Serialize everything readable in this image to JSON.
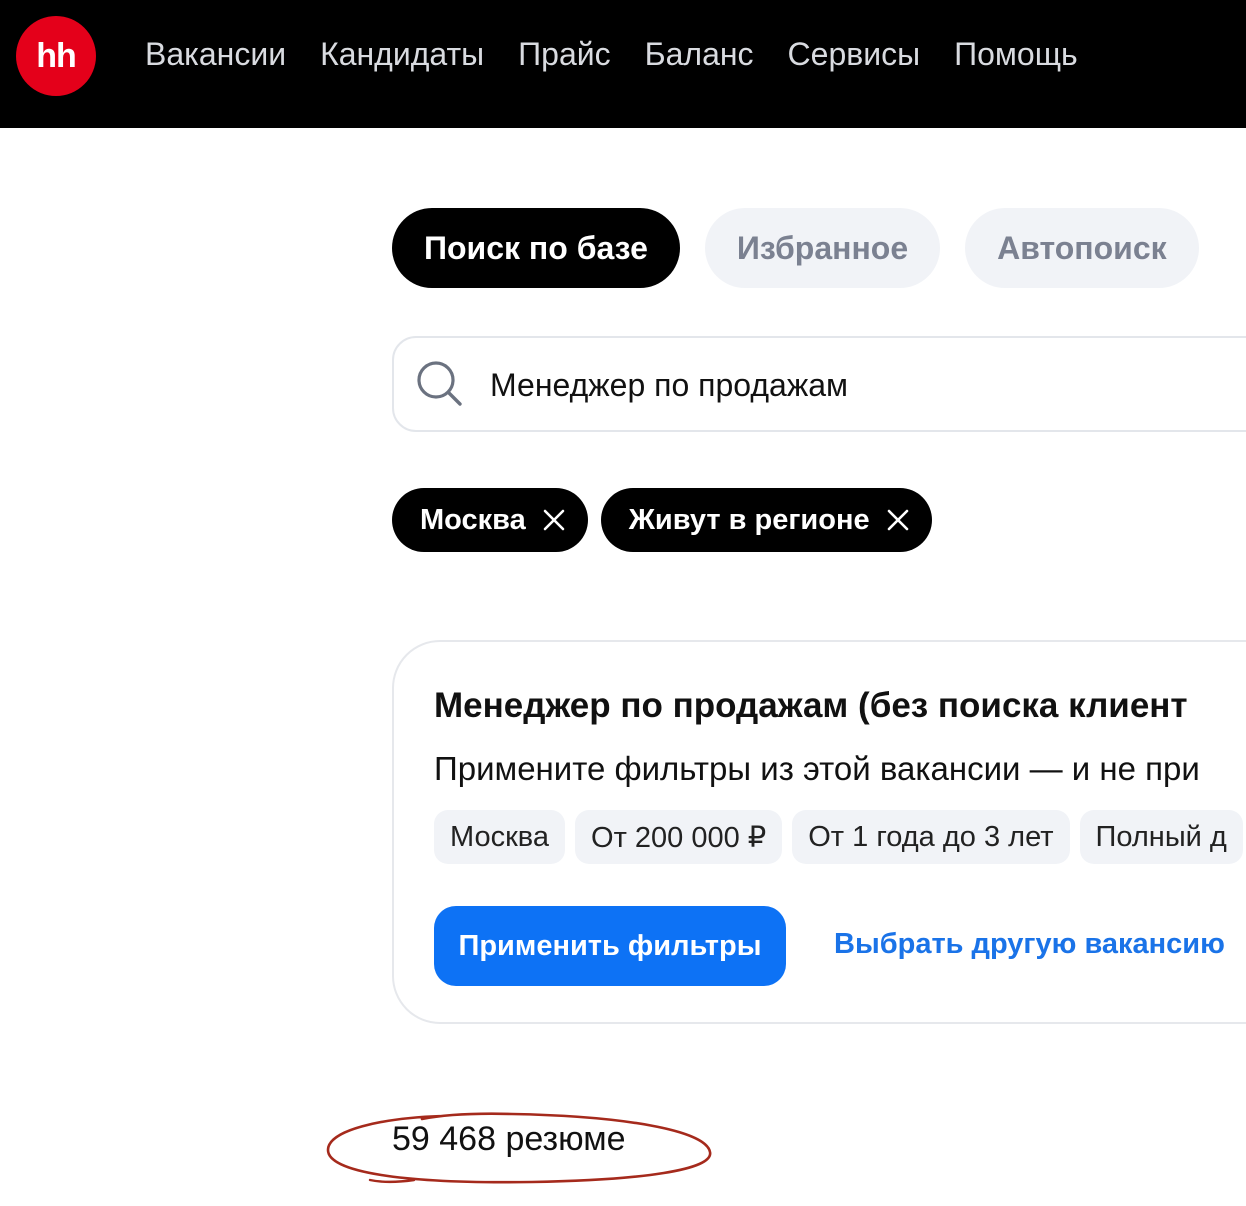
{
  "header": {
    "logo_text": "hh",
    "logo_color": "#e4001a",
    "nav": [
      "Вакансии",
      "Кандидаты",
      "Прайс",
      "Баланс",
      "Сервисы",
      "Помощь"
    ]
  },
  "tabs": [
    {
      "label": "Поиск по базе",
      "active": true
    },
    {
      "label": "Избранное",
      "active": false
    },
    {
      "label": "Автопоиск",
      "active": false
    }
  ],
  "search": {
    "icon": "search-icon",
    "value": "Менеджер по продажам"
  },
  "filters": [
    {
      "label": "Москва",
      "icon": "close-icon"
    },
    {
      "label": "Живут в регионе",
      "icon": "close-icon"
    }
  ],
  "vacancy_card": {
    "title": "Менеджер по продажам (без поиска клиент",
    "description": "Примените фильтры из этой вакансии — и не при",
    "tags": [
      "Москва",
      "От 200 000 ₽",
      "От 1 года до 3 лет",
      "Полный д"
    ],
    "apply_button": "Применить фильтры",
    "other_link": "Выбрать другую вакансию",
    "button_color": "#0d72f5"
  },
  "results": {
    "count_text": "59 468 резюме",
    "annotation_color": "#a52a1c"
  }
}
